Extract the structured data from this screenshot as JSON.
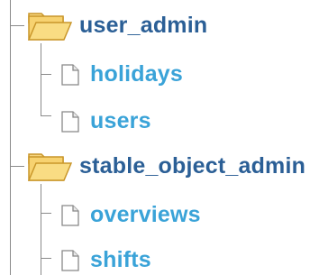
{
  "tree": {
    "folders": [
      {
        "label": "user_admin",
        "icon": "folder-open-icon",
        "files": [
          {
            "label": "holidays",
            "icon": "file-icon"
          },
          {
            "label": "users",
            "icon": "file-icon"
          }
        ]
      },
      {
        "label": "stable_object_admin",
        "icon": "folder-open-icon",
        "files": [
          {
            "label": "overviews",
            "icon": "file-icon"
          },
          {
            "label": "shifts",
            "icon": "file-icon"
          }
        ]
      }
    ]
  },
  "colors": {
    "folder_label": "#2b5f96",
    "file_label": "#3aa3d8",
    "folder_fill": "#f3c95b",
    "folder_outline": "#c9962a",
    "connector": "#8a8a8a"
  }
}
